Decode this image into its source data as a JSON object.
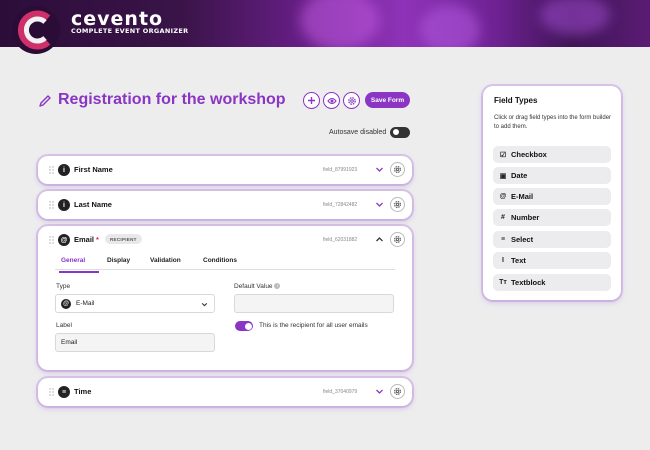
{
  "brand": {
    "name": "cevento",
    "tagline": "COMPLETE EVENT ORGANIZER"
  },
  "page": {
    "title": "Registration for the workshop",
    "save_label": "Save Form",
    "autosave_label": "Autosave disabled",
    "autosave_enabled": false
  },
  "fields": [
    {
      "name": "First Name",
      "id": "field_87991923",
      "icon": "info-circle-icon",
      "expanded": false
    },
    {
      "name": "Last Name",
      "id": "field_72842482",
      "icon": "info-circle-icon",
      "expanded": false
    },
    {
      "name": "Email",
      "id": "field_62031882",
      "icon": "at-icon",
      "expanded": true,
      "required_mark": "*",
      "badge": "RECIPIENT"
    },
    {
      "name": "Time",
      "id": "field_37040979",
      "icon": "list-icon",
      "expanded": false
    }
  ],
  "editor": {
    "tabs": [
      "General",
      "Display",
      "Validation",
      "Conditions"
    ],
    "active_tab": "General",
    "type_label": "Type",
    "type_value": "E-Mail",
    "default_label": "Default Value",
    "default_value": "",
    "label_label": "Label",
    "label_value": "Email",
    "recipient_toggle_label": "This is the recipient for all user emails",
    "recipient_enabled": true
  },
  "panel": {
    "title": "Field Types",
    "description": "Click or drag field types into the form builder to add them.",
    "items": [
      {
        "label": "Checkbox",
        "icon": "checkbox-icon",
        "glyph": "☑"
      },
      {
        "label": "Date",
        "icon": "calendar-icon",
        "glyph": "▣"
      },
      {
        "label": "E-Mail",
        "icon": "at-icon",
        "glyph": "@"
      },
      {
        "label": "Number",
        "icon": "hash-icon",
        "glyph": "#"
      },
      {
        "label": "Select",
        "icon": "list-icon",
        "glyph": "≡"
      },
      {
        "label": "Text",
        "icon": "text-cursor-icon",
        "glyph": "I"
      },
      {
        "label": "Textblock",
        "icon": "textblock-icon",
        "glyph": "Tт"
      }
    ]
  },
  "colors": {
    "accent": "#8a35c4",
    "text": "#222222",
    "background": "#ededee"
  }
}
